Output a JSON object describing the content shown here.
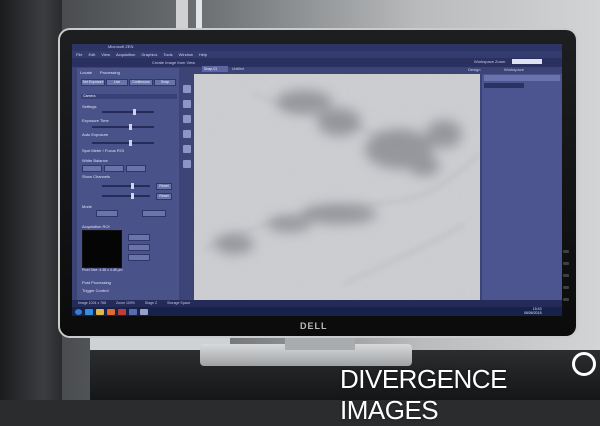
{
  "app": {
    "title": "Microsoft ZEN",
    "menus": [
      "File",
      "Edit",
      "View",
      "Acquisition",
      "Graphics",
      "Tools",
      "Window",
      "Help"
    ],
    "toolbar_caption": "Create Image from View",
    "workspace_zoom_label": "Workspace Zoom",
    "design_label": "Design",
    "workspace_label": "Workspace"
  },
  "left_panel": {
    "tabs": [
      "Locate",
      "Processing"
    ],
    "buttons": [
      "Set Exposure",
      "Live",
      "Continuous",
      "Snap"
    ],
    "labels": [
      "Settings",
      "Exposure Time",
      "Auto Exposure",
      "Spot Meter / Focus ROI",
      "White Balance",
      "Show Channels",
      "Mode",
      "Acquisition ROI",
      "Post Processing",
      "Trigger Control"
    ],
    "sections": [
      "Camera"
    ],
    "pixel_size": "Pixel Size: 4.48 x 4.48 µm",
    "reset_button": "Reset"
  },
  "viewer": {
    "tab_label": "Snap-01",
    "path": "Untitled"
  },
  "status_bar": [
    "Image 1024 x 768",
    "Zoom 100%",
    "Stage Z",
    "Storage Space"
  ],
  "taskbar": {
    "time": "15:43",
    "date": "06/06/2018"
  },
  "monitor": {
    "brand": "DELL"
  },
  "watermark": {
    "text": "DIVERGENCE IMAGES"
  },
  "colors": {
    "ui_blue": "#3c4476",
    "panel_blue": "#4a528a",
    "sample_gray": "#c7c8cc",
    "stain_dark": "#5b5d63"
  },
  "icons": [
    "windows-start-icon",
    "ie-icon",
    "folder-icon",
    "media-icon",
    "app-icon"
  ]
}
